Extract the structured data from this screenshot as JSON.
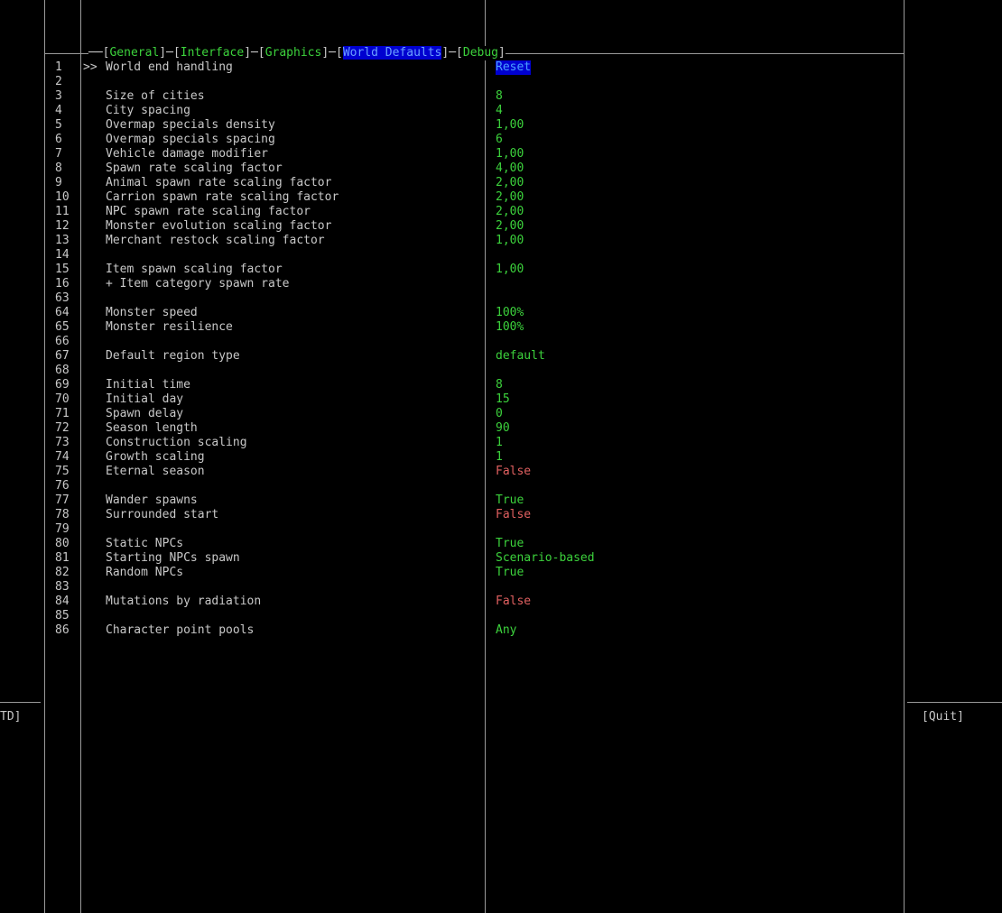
{
  "tabs": [
    {
      "label": "General",
      "active": false
    },
    {
      "label": "Interface",
      "active": false
    },
    {
      "label": "Graphics",
      "active": false
    },
    {
      "label": "World Defaults",
      "active": true
    },
    {
      "label": "Debug",
      "active": false
    }
  ],
  "left_hint": "TD]",
  "right_hint": "[Quit]",
  "cursor": ">>",
  "rows": [
    {
      "num": "1",
      "label": "World end handling",
      "value": "Reset",
      "color": "selected"
    },
    {
      "num": "2",
      "label": "",
      "value": "",
      "color": "green"
    },
    {
      "num": "3",
      "label": "Size of cities",
      "value": "8",
      "color": "green"
    },
    {
      "num": "4",
      "label": "City spacing",
      "value": "4",
      "color": "green"
    },
    {
      "num": "5",
      "label": "Overmap specials density",
      "value": "1,00",
      "color": "green"
    },
    {
      "num": "6",
      "label": "Overmap specials spacing",
      "value": "6",
      "color": "green"
    },
    {
      "num": "7",
      "label": "Vehicle damage modifier",
      "value": "1,00",
      "color": "green"
    },
    {
      "num": "8",
      "label": "Spawn rate scaling factor",
      "value": "4,00",
      "color": "green"
    },
    {
      "num": "9",
      "label": "Animal spawn rate scaling factor",
      "value": "2,00",
      "color": "green"
    },
    {
      "num": "10",
      "label": "Carrion spawn rate scaling factor",
      "value": "2,00",
      "color": "green"
    },
    {
      "num": "11",
      "label": "NPC spawn rate scaling factor",
      "value": "2,00",
      "color": "green"
    },
    {
      "num": "12",
      "label": "Monster evolution scaling factor",
      "value": "2,00",
      "color": "green"
    },
    {
      "num": "13",
      "label": "Merchant restock scaling factor",
      "value": "1,00",
      "color": "green"
    },
    {
      "num": "14",
      "label": "",
      "value": "",
      "color": "green"
    },
    {
      "num": "15",
      "label": "Item spawn scaling factor",
      "value": "1,00",
      "color": "green"
    },
    {
      "num": "16",
      "label": "+ Item category spawn rate",
      "value": "",
      "color": "green"
    },
    {
      "num": "63",
      "label": "",
      "value": "",
      "color": "green"
    },
    {
      "num": "64",
      "label": "Monster speed",
      "value": "100%",
      "color": "green"
    },
    {
      "num": "65",
      "label": "Monster resilience",
      "value": "100%",
      "color": "green"
    },
    {
      "num": "66",
      "label": "",
      "value": "",
      "color": "green"
    },
    {
      "num": "67",
      "label": "Default region type",
      "value": "default",
      "color": "green"
    },
    {
      "num": "68",
      "label": "",
      "value": "",
      "color": "green"
    },
    {
      "num": "69",
      "label": "Initial time",
      "value": "8",
      "color": "green"
    },
    {
      "num": "70",
      "label": "Initial day",
      "value": "15",
      "color": "green"
    },
    {
      "num": "71",
      "label": "Spawn delay",
      "value": "0",
      "color": "green"
    },
    {
      "num": "72",
      "label": "Season length",
      "value": "90",
      "color": "green"
    },
    {
      "num": "73",
      "label": "Construction scaling",
      "value": "1",
      "color": "green"
    },
    {
      "num": "74",
      "label": "Growth scaling",
      "value": "1",
      "color": "green"
    },
    {
      "num": "75",
      "label": "Eternal season",
      "value": "False",
      "color": "red"
    },
    {
      "num": "76",
      "label": "",
      "value": "",
      "color": "green"
    },
    {
      "num": "77",
      "label": "Wander spawns",
      "value": "True",
      "color": "green"
    },
    {
      "num": "78",
      "label": "Surrounded start",
      "value": "False",
      "color": "red"
    },
    {
      "num": "79",
      "label": "",
      "value": "",
      "color": "green"
    },
    {
      "num": "80",
      "label": "Static NPCs",
      "value": "True",
      "color": "green"
    },
    {
      "num": "81",
      "label": "Starting NPCs spawn",
      "value": "Scenario-based",
      "color": "green"
    },
    {
      "num": "82",
      "label": "Random NPCs",
      "value": "True",
      "color": "green"
    },
    {
      "num": "83",
      "label": "",
      "value": "",
      "color": "green"
    },
    {
      "num": "84",
      "label": "Mutations by radiation",
      "value": "False",
      "color": "red"
    },
    {
      "num": "85",
      "label": "",
      "value": "",
      "color": "green"
    },
    {
      "num": "86",
      "label": "Character point pools",
      "value": "Any",
      "color": "green"
    }
  ]
}
